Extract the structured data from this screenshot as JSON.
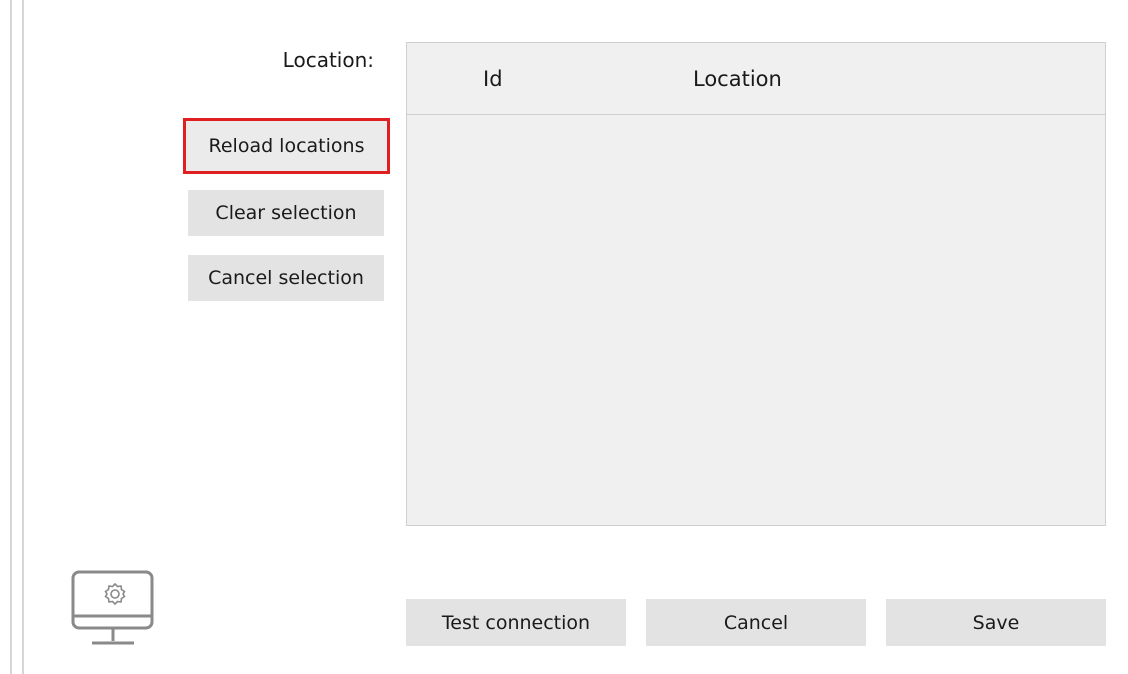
{
  "form": {
    "location_label": "Location:"
  },
  "side_buttons": {
    "reload": "Reload locations",
    "clear": "Clear selection",
    "cancel_selection": "Cancel selection"
  },
  "grid": {
    "columns": [
      "Id",
      "Location"
    ],
    "rows": []
  },
  "footer": {
    "test_connection": "Test connection",
    "cancel": "Cancel",
    "save": "Save"
  },
  "icons": {
    "settings_monitor": "monitor-gear-icon"
  },
  "colors": {
    "highlight_border": "#e02020",
    "button_bg": "#e3e3e3",
    "grid_bg": "#f0f0f0"
  }
}
